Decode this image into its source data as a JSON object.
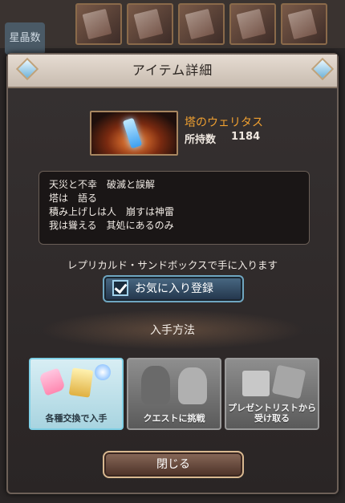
{
  "background": {
    "side_tab_label": "星晶数"
  },
  "dialog": {
    "title": "アイテム詳細",
    "item": {
      "name": "塔のウェリタス",
      "owned_label": "所持数",
      "owned_count": "1184",
      "flavor_lines": [
        "天災と不幸　破滅と誤解",
        "塔は　語る",
        "積み上げしは人　崩すは神雷",
        "我は聳える　其処にあるのみ"
      ]
    },
    "source_note": "レプリカルド・サンドボックスで手に入ります",
    "favorite_button_label": "お気に入り登録",
    "acquire_section_title": "入手方法",
    "methods": [
      {
        "label": "各種交換で入手"
      },
      {
        "label": "クエストに挑戦"
      },
      {
        "label_line1": "プレゼントリストから",
        "label_line2": "受け取る"
      }
    ],
    "close_button_label": "閉じる"
  },
  "colors": {
    "accent_orange": "#f0a030",
    "favorite_blue": "#4a6a84",
    "active_card": "#a8d4e0"
  }
}
